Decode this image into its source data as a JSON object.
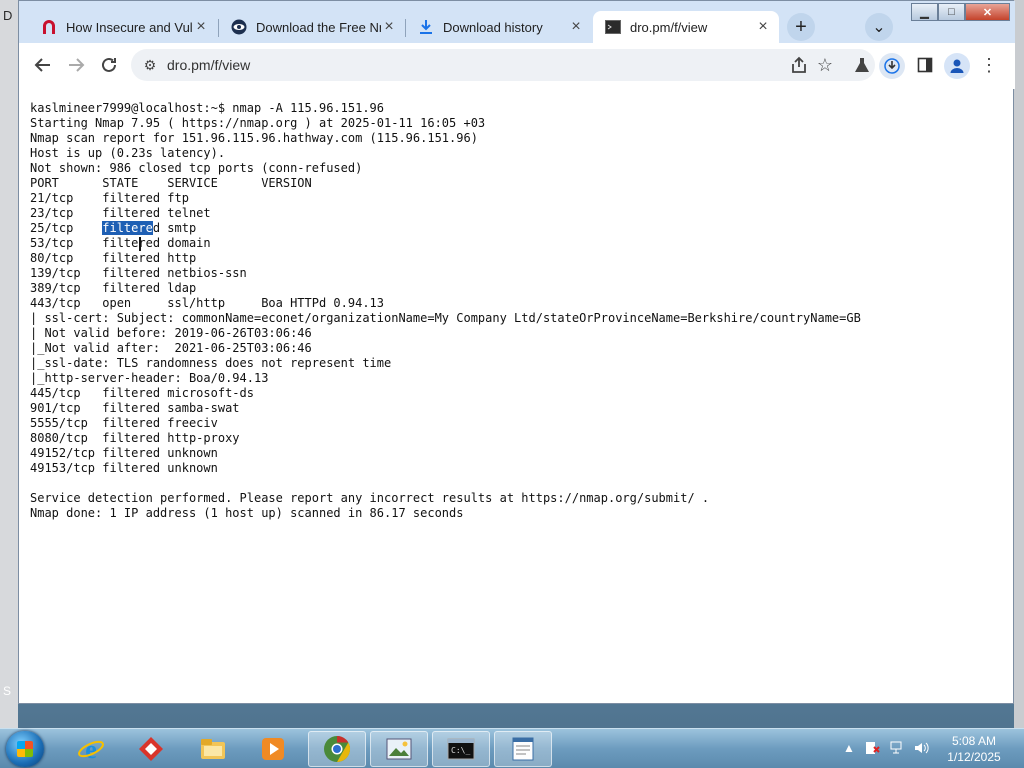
{
  "browser": {
    "tabs": [
      {
        "title": "How Insecure and Vuln",
        "favicon": "netsparker-n-icon",
        "active": false
      },
      {
        "title": "Download the Free Nm",
        "favicon": "nmap-eye-icon",
        "active": false
      },
      {
        "title": "Download history",
        "favicon": "download-icon",
        "active": false
      },
      {
        "title": "dro.pm/f/view",
        "favicon": "terminal-favicon-icon",
        "active": true
      }
    ],
    "new_tab": "+",
    "tab_search": "⌄",
    "address": "dro.pm/f/view"
  },
  "terminal": {
    "lines": [
      "kaslmineer7999@localhost:~$ nmap -A 115.96.151.96",
      "Starting Nmap 7.95 ( https://nmap.org ) at 2025-01-11 16:05 +03",
      "Nmap scan report for 151.96.115.96.hathway.com (115.96.151.96)",
      "Host is up (0.23s latency).",
      "Not shown: 986 closed tcp ports (conn-refused)",
      "PORT      STATE    SERVICE      VERSION",
      "21/tcp    filtered ftp",
      "23/tcp    filtered telnet",
      "25/tcp    filtered smtp",
      "53/tcp    filtered domain",
      "80/tcp    filtered http",
      "139/tcp   filtered netbios-ssn",
      "389/tcp   filtered ldap",
      "443/tcp   open     ssl/http     Boa HTTPd 0.94.13",
      "| ssl-cert: Subject: commonName=econet/organizationName=My Company Ltd/stateOrProvinceName=Berkshire/countryName=GB",
      "| Not valid before: 2019-06-26T03:06:46",
      "|_Not valid after:  2021-06-25T03:06:46",
      "|_ssl-date: TLS randomness does not represent time",
      "|_http-server-header: Boa/0.94.13",
      "445/tcp   filtered microsoft-ds",
      "901/tcp   filtered samba-swat",
      "5555/tcp  filtered freeciv",
      "8080/tcp  filtered http-proxy",
      "49152/tcp filtered unknown",
      "49153/tcp filtered unknown",
      "",
      "Service detection performed. Please report any incorrect results at https://nmap.org/submit/ .",
      "Nmap done: 1 IP address (1 host up) scanned in 86.17 seconds"
    ],
    "selected_text": "filtere"
  },
  "taskbar": {
    "apps": [
      "internet-explorer-icon",
      "gitkraken-icon",
      "file-explorer-icon",
      "media-player-icon",
      "chrome-icon",
      "image-viewer-icon",
      "command-prompt-icon",
      "notepad-icon"
    ],
    "time": "5:08 AM",
    "date": "1/12/2025"
  },
  "colors": {
    "selection": "#1e5fb4",
    "tab_strip": "#d3e3f6",
    "taskbar": "#6d9cbf"
  }
}
